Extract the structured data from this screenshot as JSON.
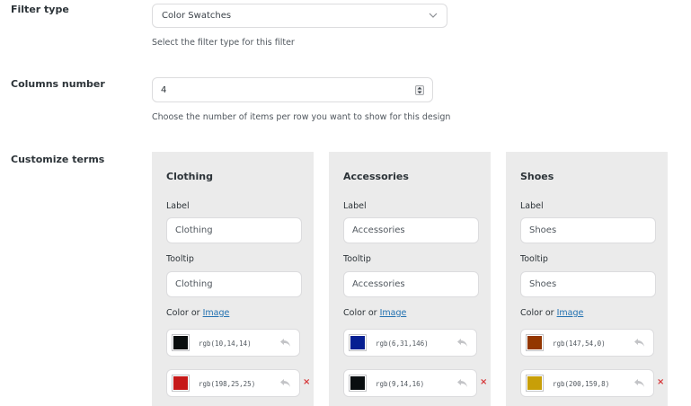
{
  "filter_type": {
    "label": "Filter type",
    "value": "Color Swatches",
    "help": "Select the filter type for this filter"
  },
  "columns": {
    "label": "Columns number",
    "value": "4",
    "help": "Choose the number of items per row you want to show for this design"
  },
  "customize": {
    "label": "Customize terms",
    "label_caption": "Label",
    "tooltip_caption": "Tooltip",
    "color_caption": "Color or",
    "image_link": "Image",
    "remove_glyph": "×",
    "cards": [
      {
        "title": "Clothing",
        "label_value": "Clothing",
        "tooltip_value": "Clothing",
        "colors": [
          {
            "code": "rgb(10,14,14)",
            "hex": "#0a0e0e"
          },
          {
            "code": "rgb(198,25,25)",
            "hex": "#c61919"
          }
        ]
      },
      {
        "title": "Accessories",
        "label_value": "Accessories",
        "tooltip_value": "Accessories",
        "colors": [
          {
            "code": "rgb(6,31,146)",
            "hex": "#061f92"
          },
          {
            "code": "rgb(9,14,16)",
            "hex": "#090e10"
          }
        ]
      },
      {
        "title": "Shoes",
        "label_value": "Shoes",
        "tooltip_value": "Shoes",
        "colors": [
          {
            "code": "rgb(147,54,0)",
            "hex": "#933600"
          },
          {
            "code": "rgb(200,159,8)",
            "hex": "#c89f08"
          }
        ]
      }
    ]
  }
}
